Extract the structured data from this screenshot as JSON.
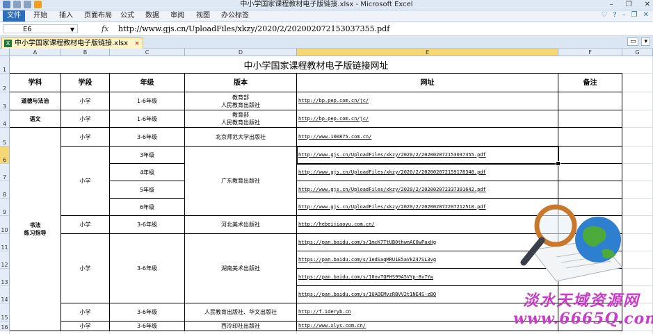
{
  "window": {
    "title": "中小学国家课程教材电子版链接.xlsx - Microsoft Excel",
    "controls": [
      "–",
      "❐",
      "✕"
    ]
  },
  "ribbon": {
    "file": "文件",
    "tabs": [
      "开始",
      "插入",
      "页面布局",
      "公式",
      "数据",
      "审阅",
      "视图",
      "办公标签"
    ],
    "right_icons": [
      "♡",
      "?",
      "–",
      "❐",
      "✕"
    ]
  },
  "formula_bar": {
    "name_box": "E6",
    "fx": "fx",
    "value": "http://www.gjs.cn/UploadFiles/xkzy/2020/2/202002072153037355.pdf"
  },
  "workbook_tab": {
    "label": "中小学国家课程教材电子版链接.xlsx",
    "close": "×"
  },
  "columns": [
    "A",
    "B",
    "C",
    "D",
    "E",
    "F",
    "G"
  ],
  "rows": [
    "1",
    "2",
    "3",
    "4",
    "5",
    "6",
    "7",
    "8",
    "9",
    "10",
    "11",
    "12",
    "13",
    "14",
    "15",
    "16"
  ],
  "sheet": {
    "title": "中小学国家课程教材电子版链接网址",
    "headers": [
      "学科",
      "学段",
      "年级",
      "版本",
      "网址",
      "备注"
    ],
    "subject_a": [
      "道德与法治",
      "语文",
      "书法\n练习指导"
    ],
    "stage": [
      "小学",
      "小学",
      "小学",
      "小学",
      "小学",
      "小学",
      "小学",
      "小学"
    ],
    "grade": [
      "1-6年级",
      "1-6年级",
      "3-6年级",
      "3年级",
      "4年级",
      "5年级",
      "6年级",
      "3-6年级",
      "3-6年级",
      "3-6年级",
      "3-6年级"
    ],
    "publisher": [
      "教育部\n人民教育出版社",
      "教育部\n人民教育出版社",
      "北京师范大学出版社",
      "广东教育出版社",
      "河北美术出版社",
      "湖南美术出版社",
      "人民教育出版社、华文出版社",
      "西泠印社出版社"
    ],
    "urls": [
      "http://bp.pep.com.cn/jc/",
      "http://bp.pep.com.cn/jc/",
      "http://www.100875.com.cn/",
      "http://www.gjs.cn/UploadFiles/xkzy/2020/2/202002072153037355.pdf",
      "http://www.gjs.cn/UploadFiles/xkzy/2020/2/202002072159178348.pdf",
      "http://www.gjs.cn/UploadFiles/xkzy/2020/2/202002072337391642.pdf",
      "http://www.gjs.cn/UploadFiles/xkzy/2020/2/202002072207212510.pdf",
      "http://hebeijiaoyu.com.cn/",
      "https://pan.baidu.com/s/1mcK7TtUB0thwnAC0wPaxHg",
      "https://pan.baidu.com/s/1edSaqMRU1E5aVkZ47SL3vg",
      "https://pan.baidu.com/s/10ovTQFHS99A5VYp-8v7Yw",
      "https://pan.baidu.com/s/1UAOEMvzRBVV2t1NE4S-zBQ",
      "http://f.ideryb.cn",
      "http://www.xlys.com.cn/"
    ]
  },
  "watermark": {
    "line1": "淡水天域资源网",
    "line2": "www.6665Q.com"
  },
  "colors": {
    "file_tab": "#2a6ebd",
    "selected_header": "#f7d774",
    "watermark": "#c83cc8"
  }
}
